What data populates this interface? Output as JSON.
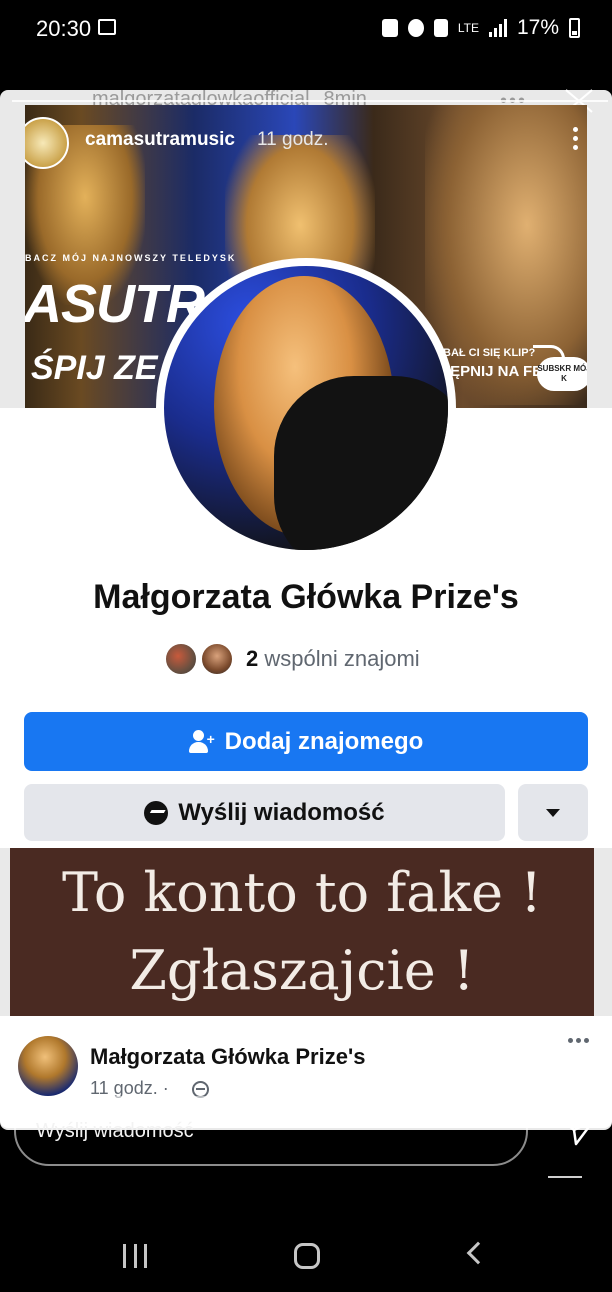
{
  "status_bar": {
    "time": "20:30",
    "network": "LTE",
    "battery": "17%"
  },
  "story_overlay": {
    "username": "malgorzataglowkaofficial",
    "time": "8min",
    "more": "•••"
  },
  "cover_post": {
    "username": "camasutramusic",
    "time": "11 godz.",
    "small_text": "BACZ MÓJ NAJNOWSZY TELEDYSK",
    "big_text_1": "ASUTRA",
    "big_text_2": "ŚPIJ ZE M",
    "question_text": "BAŁ CI SIĘ KLIP?",
    "share_text": "TĘPNIJ NA FB",
    "subscribe_text": "SUBSKR MÓJ K"
  },
  "profile": {
    "name": "Małgorzata Główka Prize's",
    "mutual_count": "2",
    "mutual_label": "wspólni znajomi"
  },
  "buttons": {
    "add_friend": "Dodaj znajomego",
    "send_message": "Wyślij wiadomość"
  },
  "banner": {
    "line1": "To konto to fake !",
    "line2": "Zgłaszajcie !"
  },
  "post": {
    "author": "Małgorzata Główka Prize's",
    "time": "11 godz. ·",
    "more": "•••"
  },
  "reply": {
    "placeholder": "Wyślij wiadomość"
  },
  "colors": {
    "facebook_blue": "#1877f2",
    "banner_bg": "#4a2a22",
    "button_grey": "#e4e6eb"
  }
}
